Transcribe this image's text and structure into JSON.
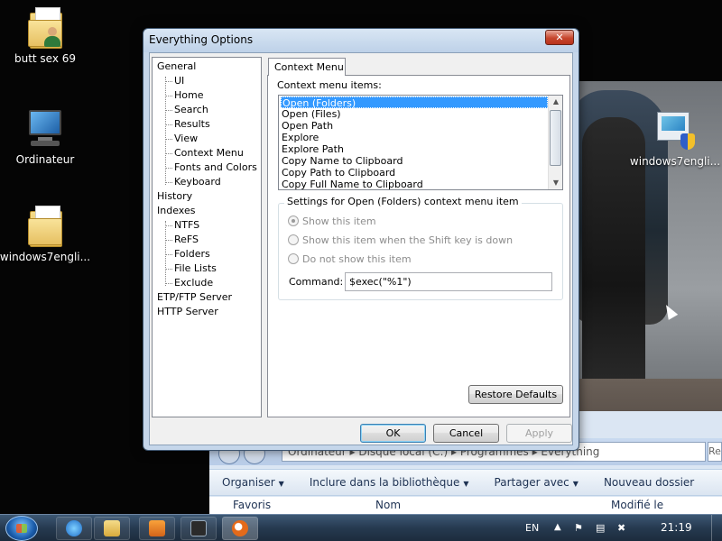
{
  "desktop": {
    "icons": [
      {
        "label": "butt sex 69",
        "icon": "folder-user-icon"
      },
      {
        "label": "Ordinateur",
        "icon": "computer-icon"
      },
      {
        "label": "windows7engli...",
        "icon": "folder-icon"
      },
      {
        "label": "windows7engli...",
        "icon": "setup-shield-icon"
      }
    ]
  },
  "dialog": {
    "title": "Everything Options",
    "close_label": "✕",
    "tree": {
      "items": [
        {
          "label": "General",
          "level": 0
        },
        {
          "label": "UI",
          "level": 1
        },
        {
          "label": "Home",
          "level": 1
        },
        {
          "label": "Search",
          "level": 1
        },
        {
          "label": "Results",
          "level": 1
        },
        {
          "label": "View",
          "level": 1
        },
        {
          "label": "Context Menu",
          "level": 1,
          "selected": true
        },
        {
          "label": "Fonts and Colors",
          "level": 1
        },
        {
          "label": "Keyboard",
          "level": 1
        },
        {
          "label": "History",
          "level": 0
        },
        {
          "label": "Indexes",
          "level": 0
        },
        {
          "label": "NTFS",
          "level": 1
        },
        {
          "label": "ReFS",
          "level": 1
        },
        {
          "label": "Folders",
          "level": 1
        },
        {
          "label": "File Lists",
          "level": 1
        },
        {
          "label": "Exclude",
          "level": 1
        },
        {
          "label": "ETP/FTP Server",
          "level": 0
        },
        {
          "label": "HTTP Server",
          "level": 0
        }
      ]
    },
    "tab_label": "Context Menu",
    "context_menu_items_label": "Context menu items:",
    "context_menu_items": [
      "Open (Folders)",
      "Open (Files)",
      "Open Path",
      "Explore",
      "Explore Path",
      "Copy Name to Clipboard",
      "Copy Path to Clipboard",
      "Copy Full Name to Clipboard"
    ],
    "selected_item": "Open (Folders)",
    "settings_group_title": "Settings for Open (Folders) context menu item",
    "options": [
      {
        "label": "Show this item",
        "checked": true
      },
      {
        "label": "Show this item when the Shift key is down",
        "checked": false
      },
      {
        "label": "Do not show this item",
        "checked": false
      }
    ],
    "command_label": "Command:",
    "command_value": "$exec(\"%1\")",
    "restore_defaults_label": "Restore Defaults",
    "ok_label": "OK",
    "cancel_label": "Cancel",
    "apply_label": "Apply"
  },
  "explorer": {
    "address": "Ordinateur  ▸  Disque local (C:)  ▸  Programmes  ▸  Everything",
    "search_placeholder": "Re",
    "commands": [
      "Organiser",
      "Inclure dans la bibliothèque",
      "Partager avec",
      "Nouveau dossier"
    ],
    "favorites_label": "Favoris",
    "col_name": "Nom",
    "col_modified": "Modifié le"
  },
  "taskbar": {
    "language": "EN",
    "clock": "21:19"
  }
}
